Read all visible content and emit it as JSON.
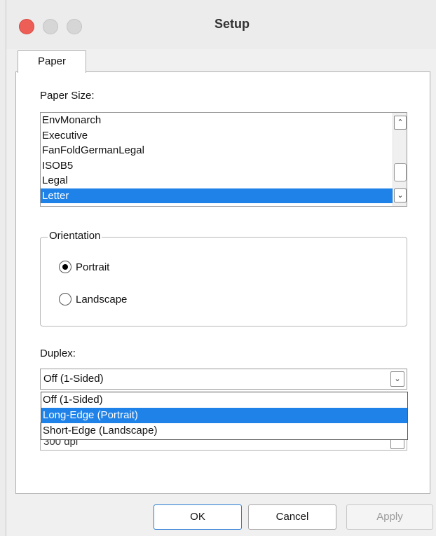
{
  "window": {
    "title": "Setup",
    "controls": [
      "close",
      "minimize",
      "maximize"
    ]
  },
  "tabs": [
    {
      "label": "Paper",
      "active": true
    }
  ],
  "paper_size": {
    "label": "Paper Size:",
    "items": [
      "EnvMonarch",
      "Executive",
      "FanFoldGermanLegal",
      "ISOB5",
      "Legal",
      "Letter"
    ],
    "selected": "Letter",
    "scroll_up_icon": "chevron-up-icon",
    "scroll_down_icon": "chevron-down-icon"
  },
  "orientation": {
    "label": "Orientation",
    "options": [
      {
        "label": "Portrait",
        "checked": true
      },
      {
        "label": "Landscape",
        "checked": false
      }
    ]
  },
  "duplex": {
    "label": "Duplex:",
    "value": "Off (1-Sided)",
    "options": [
      "Off (1-Sided)",
      "Long-Edge (Portrait)",
      "Short-Edge (Landscape)"
    ],
    "highlighted": "Long-Edge (Portrait)",
    "obscured_field_text": "300 dpi"
  },
  "buttons": {
    "ok": "OK",
    "cancel": "Cancel",
    "apply": "Apply"
  },
  "colors": {
    "selection": "#1f82e8",
    "close_button": "#ed5f56",
    "window_bg": "#f0f0f0"
  }
}
